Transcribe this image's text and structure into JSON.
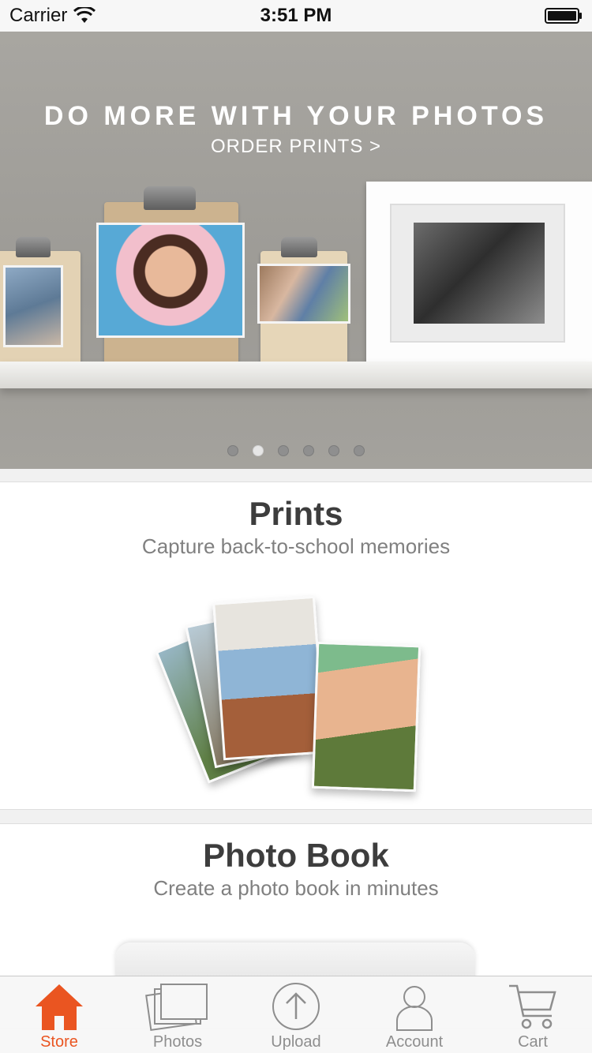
{
  "status_bar": {
    "carrier": "Carrier",
    "time": "3:51 PM"
  },
  "hero": {
    "title": "DO MORE WITH YOUR PHOTOS",
    "link": "ORDER PRINTS >",
    "page_count": 6,
    "active_page": 2
  },
  "cards": [
    {
      "title": "Prints",
      "subtitle": "Capture back-to-school memories"
    },
    {
      "title": "Photo Book",
      "subtitle": "Create a photo book in minutes"
    }
  ],
  "tabs": [
    {
      "label": "Store",
      "icon": "home-icon",
      "active": true
    },
    {
      "label": "Photos",
      "icon": "photos-icon",
      "active": false
    },
    {
      "label": "Upload",
      "icon": "upload-icon",
      "active": false
    },
    {
      "label": "Account",
      "icon": "account-icon",
      "active": false
    },
    {
      "label": "Cart",
      "icon": "cart-icon",
      "active": false
    }
  ],
  "colors": {
    "accent": "#ea5521",
    "inactive": "#8e8e8e",
    "title": "#3d3d3d"
  }
}
